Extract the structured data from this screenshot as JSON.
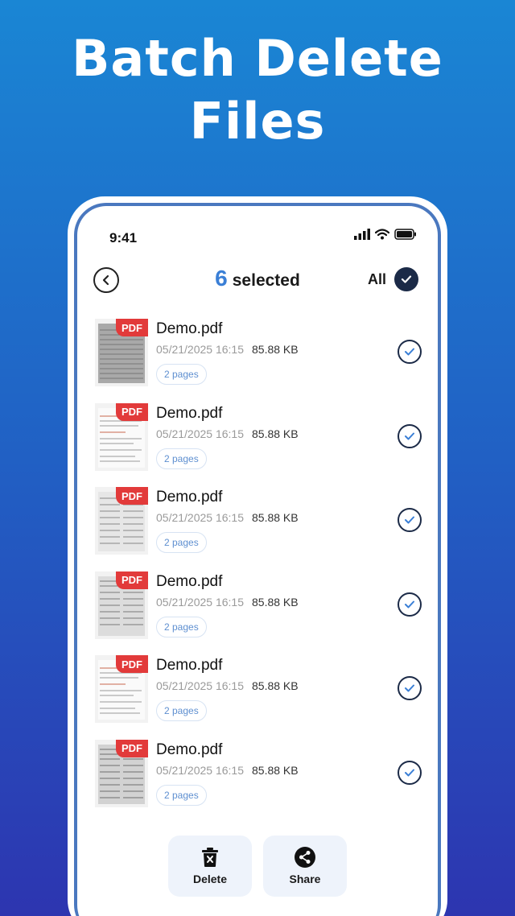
{
  "headline": {
    "line1": "Batch Delete",
    "line2": "Files"
  },
  "status_bar": {
    "time": "9:41"
  },
  "header": {
    "selected_count": "6",
    "selected_label": "selected",
    "all_label": "All"
  },
  "files": [
    {
      "name": "Demo.pdf",
      "date": "05/21/2025 16:15",
      "size": "85.88 KB",
      "pages": "2 pages",
      "badge": "PDF"
    },
    {
      "name": "Demo.pdf",
      "date": "05/21/2025 16:15",
      "size": "85.88 KB",
      "pages": "2 pages",
      "badge": "PDF"
    },
    {
      "name": "Demo.pdf",
      "date": "05/21/2025 16:15",
      "size": "85.88 KB",
      "pages": "2 pages",
      "badge": "PDF"
    },
    {
      "name": "Demo.pdf",
      "date": "05/21/2025 16:15",
      "size": "85.88 KB",
      "pages": "2 pages",
      "badge": "PDF"
    },
    {
      "name": "Demo.pdf",
      "date": "05/21/2025 16:15",
      "size": "85.88 KB",
      "pages": "2 pages",
      "badge": "PDF"
    },
    {
      "name": "Demo.pdf",
      "date": "05/21/2025 16:15",
      "size": "85.88 KB",
      "pages": "2 pages",
      "badge": "PDF"
    }
  ],
  "actions": {
    "delete_label": "Delete",
    "share_label": "Share"
  },
  "colors": {
    "accent": "#3a7fd6",
    "badge_red": "#e23a3a",
    "check_dark": "#1b2a47"
  },
  "icons": [
    "back-chevron-icon",
    "check-icon",
    "trash-icon",
    "share-icon",
    "signal-icon",
    "wifi-icon",
    "battery-icon"
  ]
}
